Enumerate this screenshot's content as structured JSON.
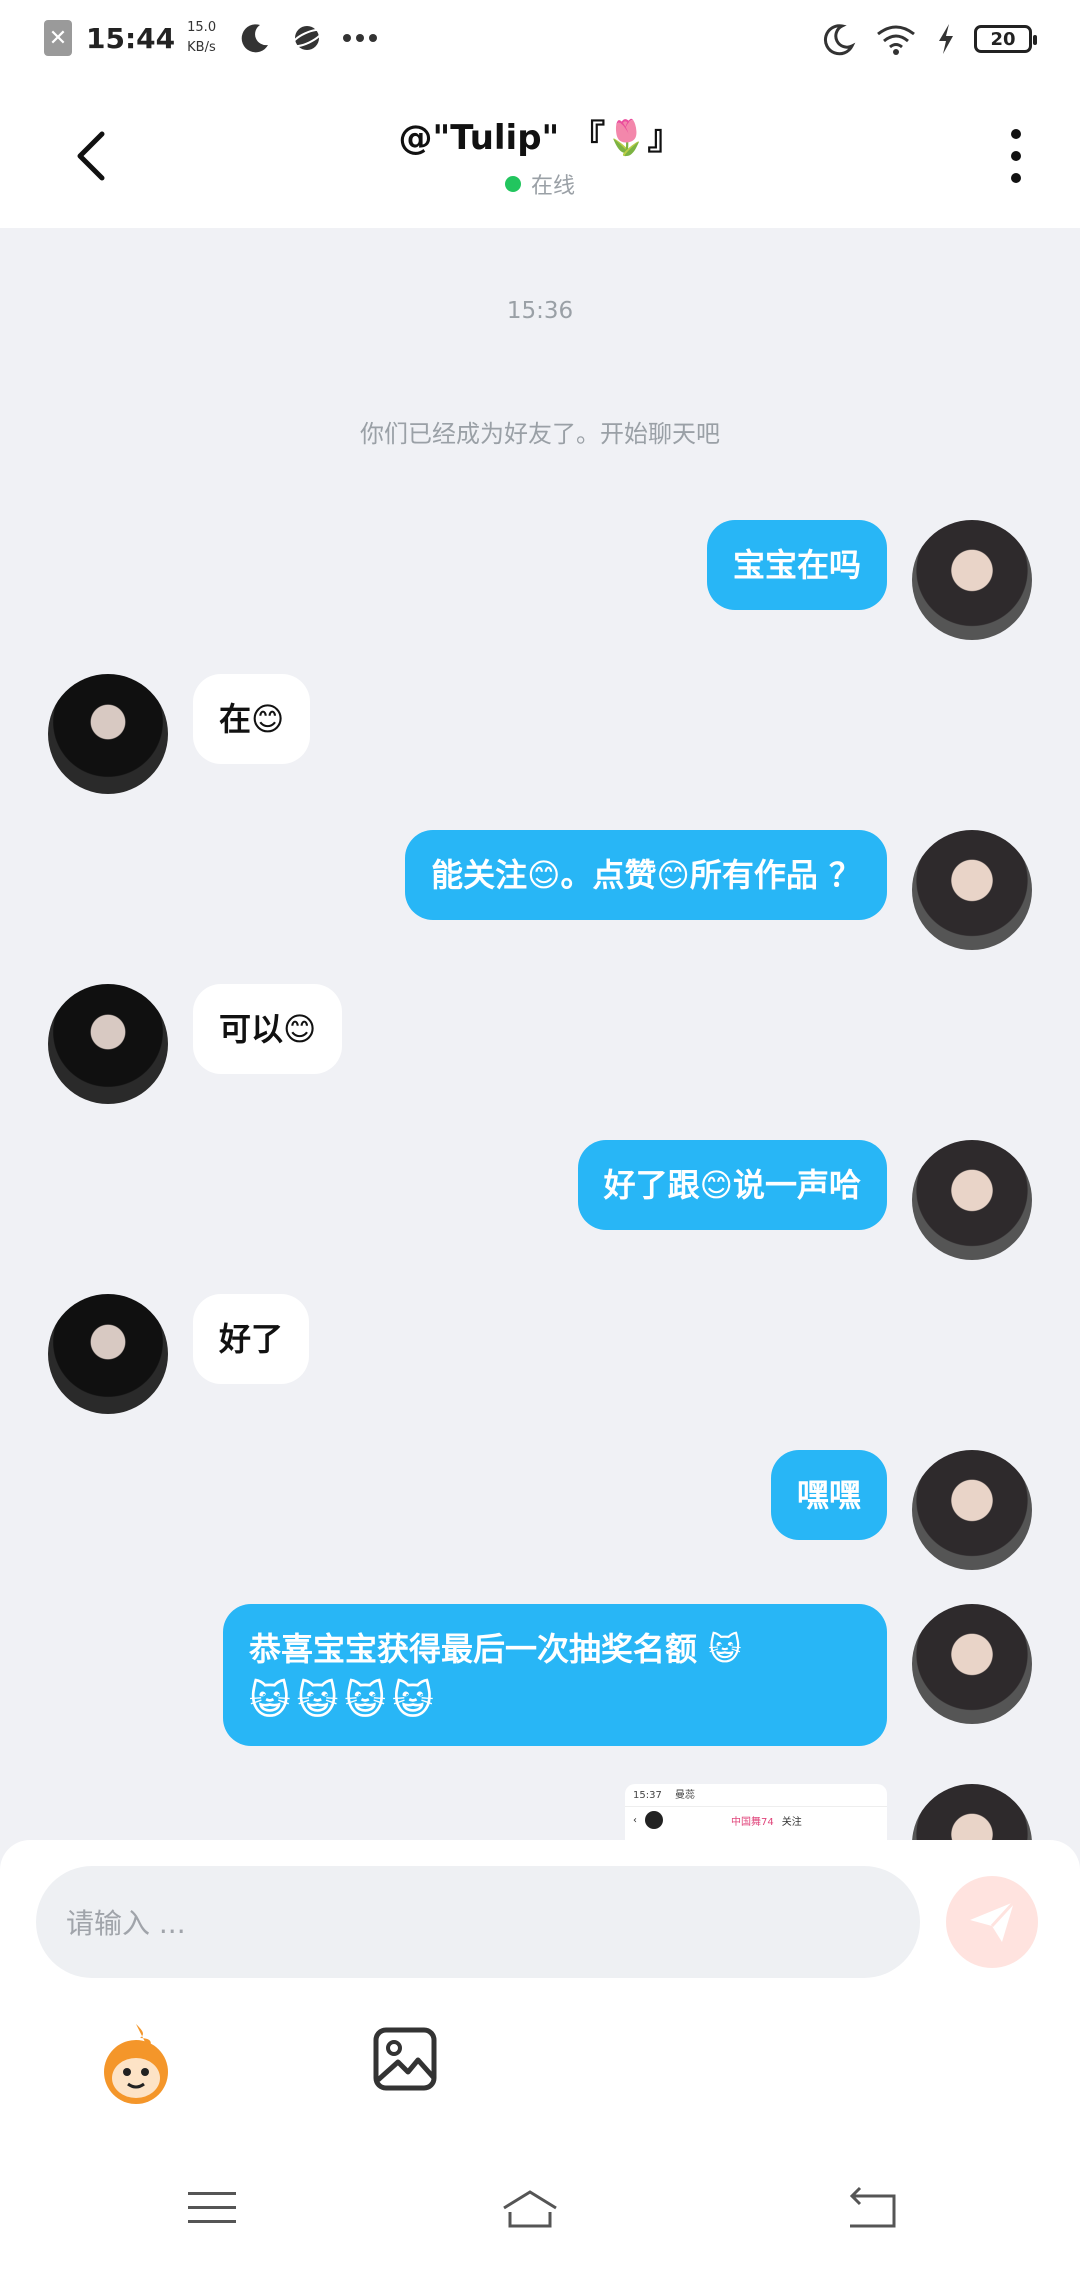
{
  "status_bar": {
    "time": "15:44",
    "speed_value": "15.0",
    "speed_unit": "KB/s",
    "battery": "20"
  },
  "header": {
    "title": "@\"Tulip\" 『🌷』",
    "status": "在线"
  },
  "chat": {
    "timestamp": "15:36",
    "system_message": "你们已经成为好友了。开始聊天吧",
    "messages": [
      {
        "from": "me",
        "text": "宝宝在吗"
      },
      {
        "from": "them",
        "text": "在😊"
      },
      {
        "from": "me",
        "text": "能关注😊。点赞😊所有作品 ？"
      },
      {
        "from": "them",
        "text": "可以😊"
      },
      {
        "from": "me",
        "text": "好了跟😊说一声哈"
      },
      {
        "from": "them",
        "text": "好了"
      },
      {
        "from": "me",
        "text": "嘿嘿"
      },
      {
        "from": "me",
        "text": "恭喜宝宝获得最后一次抽奖名额 😺",
        "stickers": "😺😺😺😺"
      }
    ],
    "preview": {
      "time": "15:37",
      "name": "曼蕊",
      "label1": "中国舞74",
      "label2": "关注"
    }
  },
  "input": {
    "placeholder": "请输入 ..."
  },
  "colors": {
    "bubble_me": "#28b6f6",
    "bubble_them": "#ffffff",
    "online": "#22c55e",
    "send": "#ffe3df"
  }
}
